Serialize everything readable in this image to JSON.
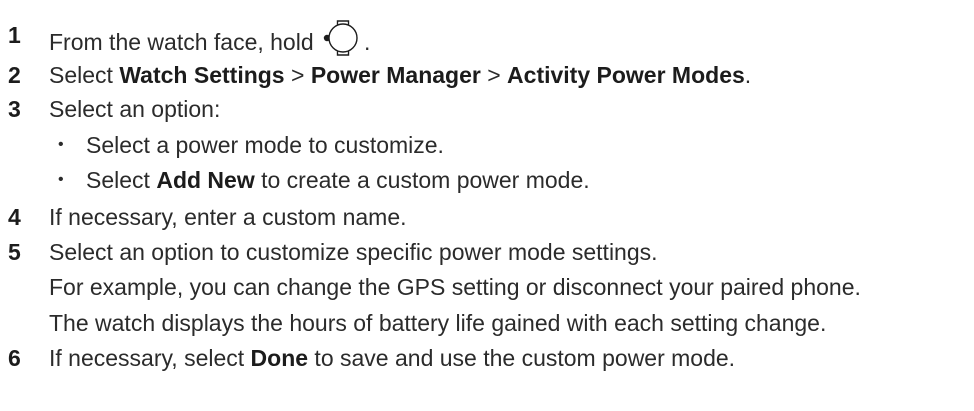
{
  "steps": [
    {
      "number": "1",
      "text_before": "From the watch face, hold ",
      "icon": "watch-button-icon",
      "text_after": "."
    },
    {
      "number": "2",
      "parts": [
        "Select ",
        "Watch Settings",
        " > ",
        "Power Manager",
        " > ",
        "Activity Power Modes",
        "."
      ]
    },
    {
      "number": "3",
      "text": "Select an option:",
      "bullets": [
        {
          "text": "Select a power mode to customize."
        },
        {
          "parts": [
            "Select ",
            "Add New",
            " to create a custom power mode."
          ]
        }
      ]
    },
    {
      "number": "4",
      "text": "If necessary, enter a custom name."
    },
    {
      "number": "5",
      "text": "Select an option to customize specific power mode settings.",
      "notes": [
        "For example, you can change the GPS setting or disconnect your paired phone.",
        "The watch displays the hours of battery life gained with each setting change."
      ]
    },
    {
      "number": "6",
      "parts": [
        "If necessary, select ",
        "Done",
        " to save and use the custom power mode."
      ]
    }
  ],
  "bullet_glyph": "•"
}
